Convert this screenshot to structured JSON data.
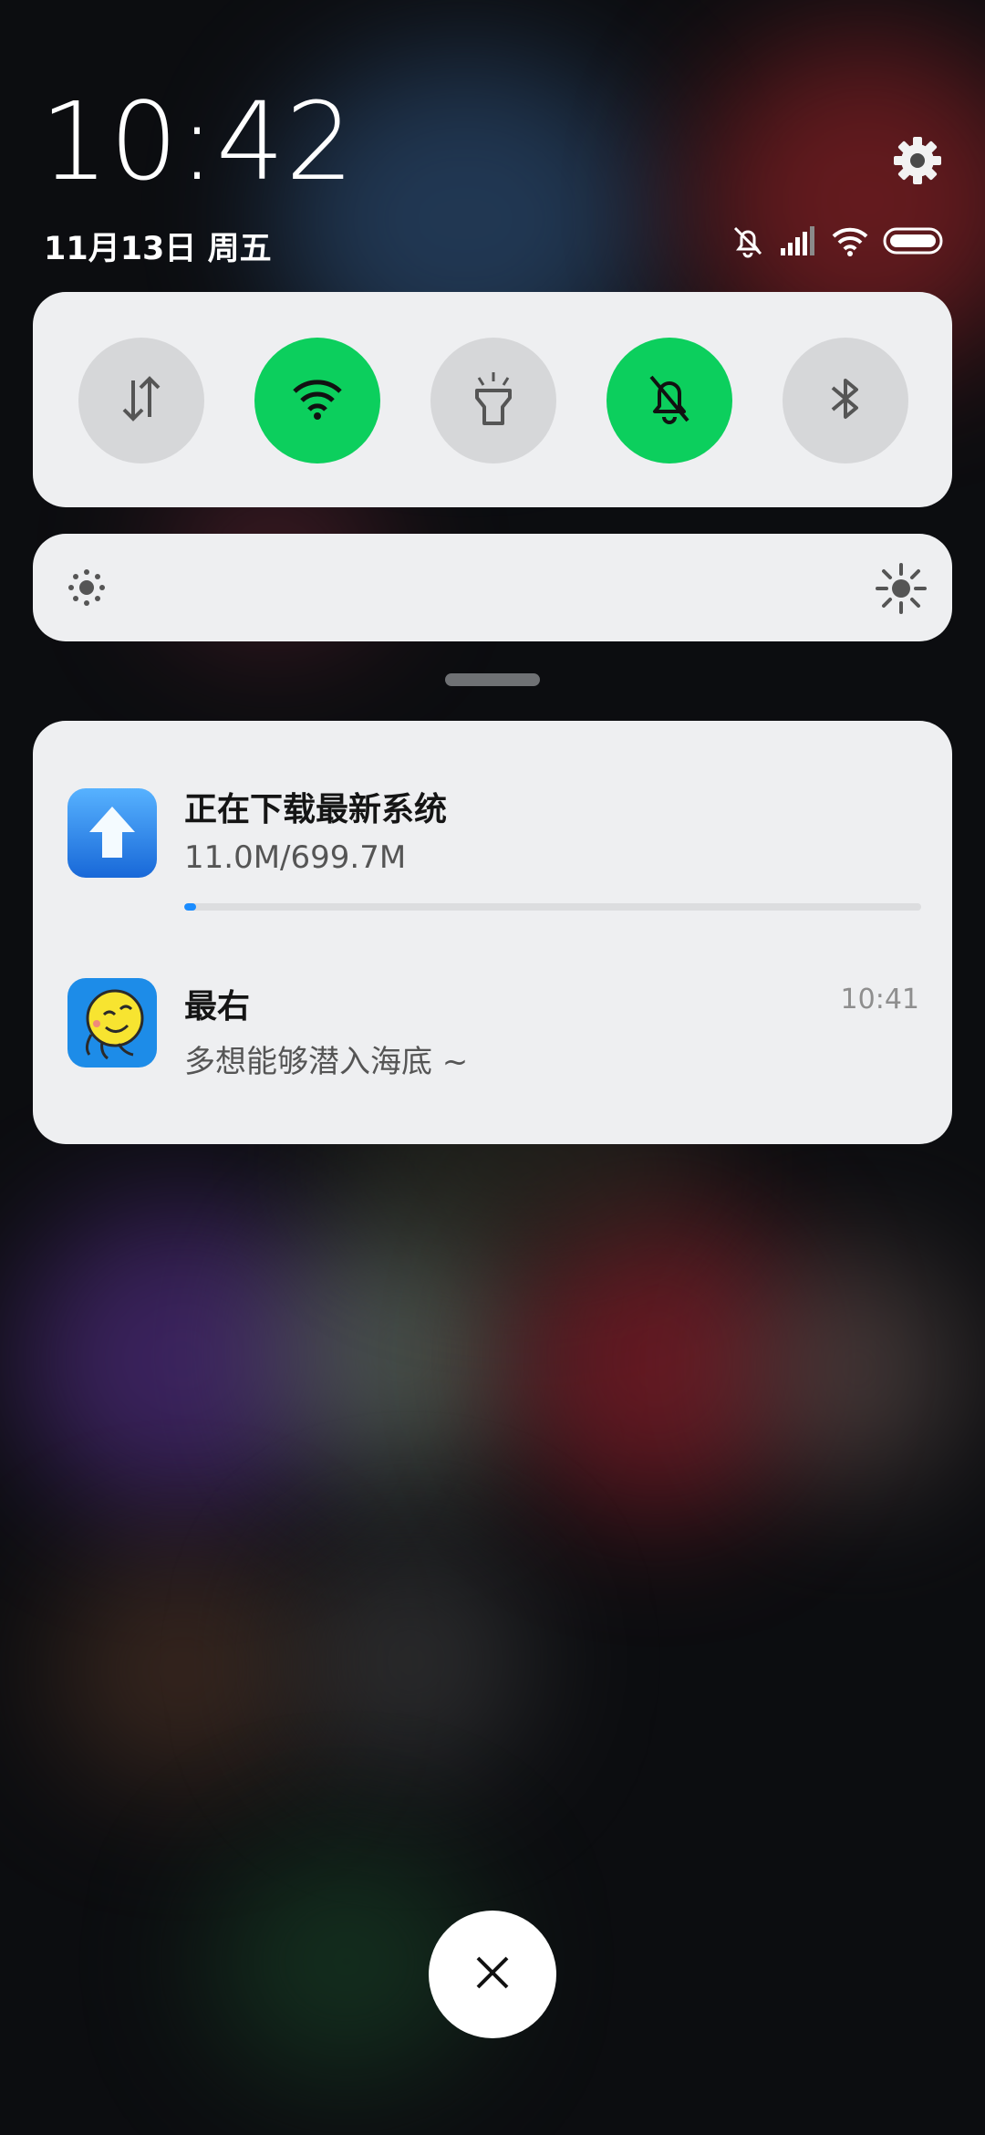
{
  "status_bar": {
    "time": "10:42",
    "date": "11月13日 周五",
    "icons": [
      "mute-bell-icon",
      "signal-icon",
      "wifi-icon",
      "battery-icon"
    ]
  },
  "settings_icon": "gear-icon",
  "quick_settings": [
    {
      "name": "mobile-data",
      "icon": "data-arrows-icon",
      "active": false
    },
    {
      "name": "wifi",
      "icon": "wifi-icon",
      "active": true
    },
    {
      "name": "flashlight",
      "icon": "flashlight-icon",
      "active": false
    },
    {
      "name": "mute",
      "icon": "mute-bell-icon",
      "active": true
    },
    {
      "name": "bluetooth",
      "icon": "bluetooth-icon",
      "active": false
    }
  ],
  "brightness": {
    "min_icon": "brightness-low-icon",
    "max_icon": "brightness-high-icon"
  },
  "notifications": [
    {
      "app_icon": "upload-arrow-icon",
      "title": "正在下载最新系统",
      "text": "11.0M/699.7M",
      "progress": 0.016
    },
    {
      "app_icon": "octopus-icon",
      "title": "最右",
      "text": "多想能够潜入海底 ~",
      "time": "10:41"
    }
  ],
  "close_icon": "close-icon",
  "colors": {
    "toggle_on": "#0ccf5d",
    "toggle_off": "#d6d7d9",
    "progress": "#1a8cff"
  }
}
